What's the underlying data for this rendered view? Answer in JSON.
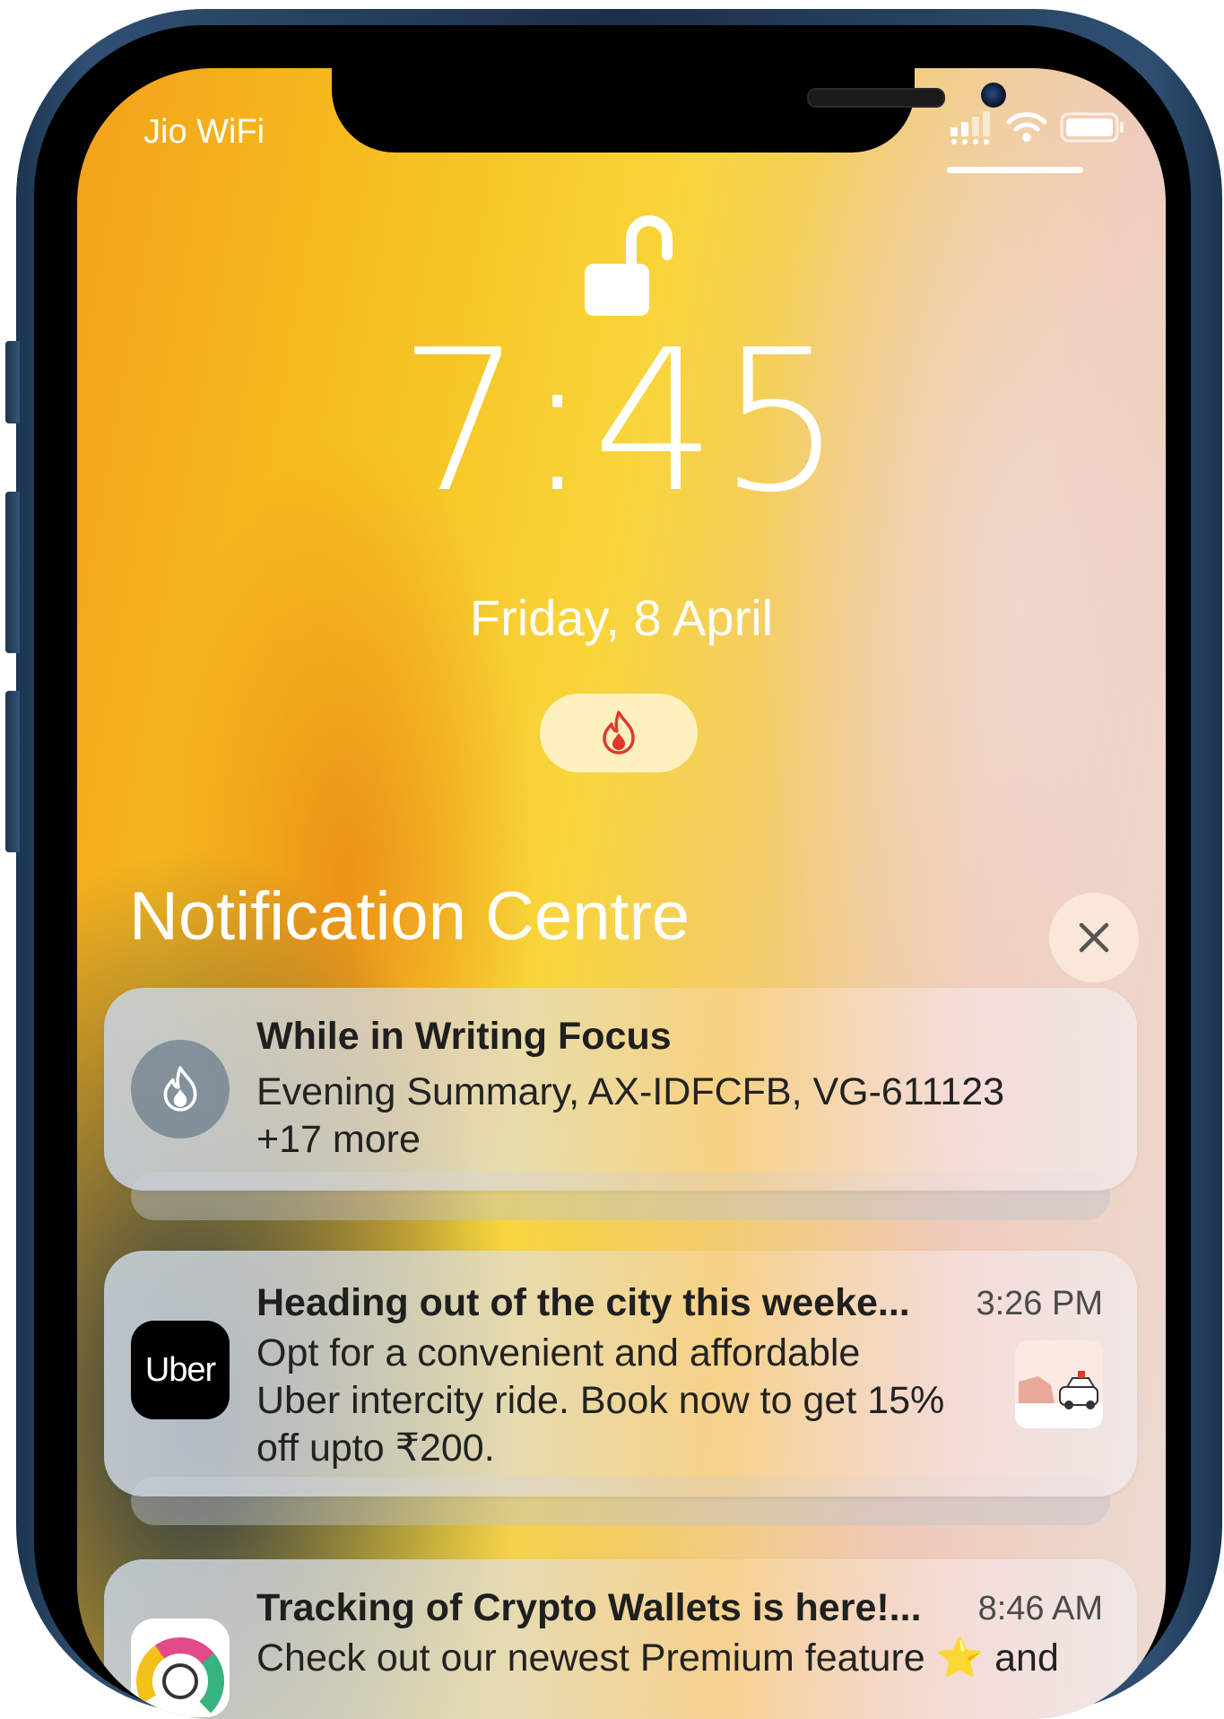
{
  "status_bar": {
    "carrier": "Jio WiFi",
    "icons": [
      "cellular-signal-icon",
      "wifi-icon",
      "battery-icon"
    ]
  },
  "lock_screen": {
    "lock_icon": "unlocked-padlock-icon",
    "time": "7:45",
    "date": "Friday, 8 April",
    "focus_icon": "flame-icon"
  },
  "notification_centre": {
    "title": "Notification Centre",
    "close_icon": "close-x-icon",
    "notifications": [
      {
        "app_icon": "writing-focus-flame-icon",
        "title": "While in Writing Focus",
        "body_line1": "Evening Summary, AX-IDFCFB, VG-611123",
        "body_line2": "+17 more"
      },
      {
        "app_icon": "uber-app-icon",
        "app_icon_text": "Uber",
        "title": "Heading out of the city this weeke...",
        "time": "3:26 PM",
        "body_line1": "Opt for a convenient and affordable",
        "body_line2": "Uber intercity ride. Book now to get 15%",
        "body_line3": "off upto ₹200.",
        "thumbnail": "car-illustration-thumbnail"
      },
      {
        "app_icon": "finance-tracker-app-icon",
        "title": "Tracking of Crypto Wallets is here!...",
        "time": "8:46 AM",
        "body_line1": "Check out our newest Premium feature ⭐ and"
      }
    ]
  },
  "colors": {
    "frame": "#2f4f72",
    "focus_accent": "#e0392b",
    "uber_bg": "#000000"
  }
}
